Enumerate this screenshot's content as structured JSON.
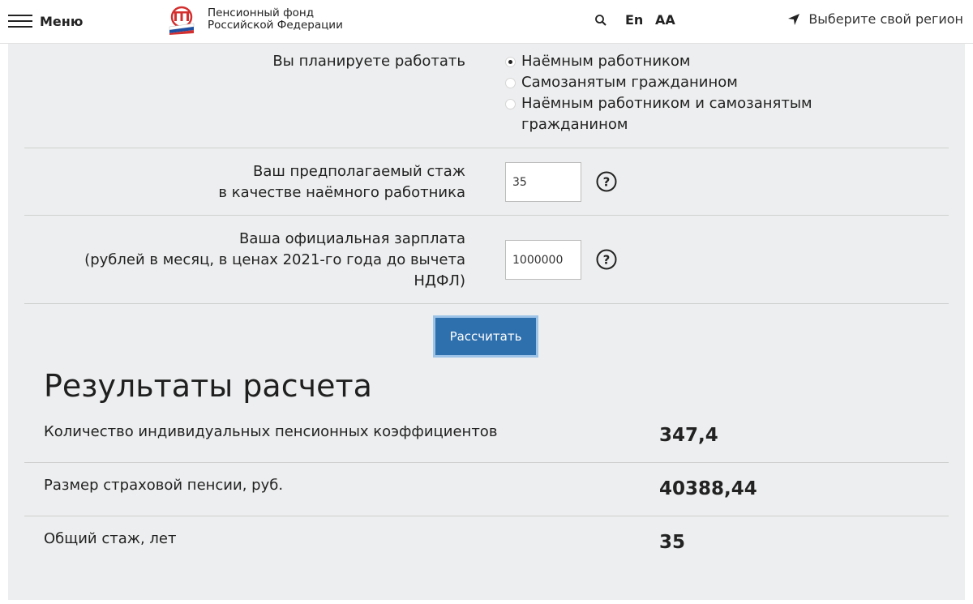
{
  "header": {
    "menu_label": "Меню",
    "brand_line1": "Пенсионный фонд",
    "brand_line2": "Российской Федерации",
    "lang_label": "En",
    "font_size_label": "AA",
    "region_label": "Выберите свой регион"
  },
  "form": {
    "work_type": {
      "label": "Вы планируете работать",
      "options": [
        {
          "label": "Наёмным работником",
          "checked": true
        },
        {
          "label": "Самозанятым гражданином",
          "checked": false
        },
        {
          "label_line1": "Наёмным работником и самозанятым",
          "label_line2": "гражданином",
          "checked": false
        }
      ]
    },
    "experience": {
      "label_line1": "Ваш предполагаемый стаж",
      "label_line2": "в качестве наёмного работника",
      "value": "35"
    },
    "salary": {
      "label_line1": "Ваша официальная зарплата",
      "label_line2": "(рублей в месяц, в ценах 2021-го года до вычета",
      "label_line3": "НДФЛ)",
      "value": "1000000"
    },
    "calculate_label": "Рассчитать"
  },
  "results": {
    "title": "Результаты расчета",
    "rows": [
      {
        "label": "Количество индивидуальных пенсионных коэффициентов",
        "value": "347,4"
      },
      {
        "label": "Размер страховой пенсии, руб.",
        "value": "40388,44"
      },
      {
        "label": "Общий стаж, лет",
        "value": "35"
      }
    ]
  },
  "colors": {
    "button": "#2e6fad",
    "panel": "#edeeef",
    "logo_red": "#d32f2f",
    "flag_blue": "#1d4fa3"
  }
}
